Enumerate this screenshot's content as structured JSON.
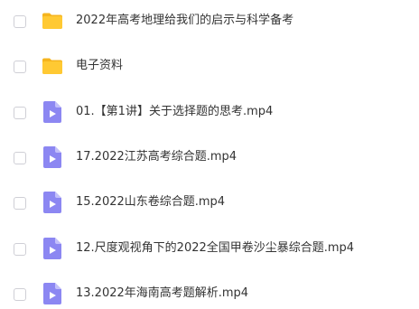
{
  "files": [
    {
      "name": "2022年高考地理给我们的启示与科学备考",
      "type": "folder",
      "icon": "folder-icon"
    },
    {
      "name": "电子资料",
      "type": "folder",
      "icon": "folder-icon"
    },
    {
      "name": "01.【第1讲】关于选择题的思考.mp4",
      "type": "video",
      "icon": "video-file-icon"
    },
    {
      "name": "17.2022江苏高考综合题.mp4",
      "type": "video",
      "icon": "video-file-icon"
    },
    {
      "name": "15.2022山东卷综合题.mp4",
      "type": "video",
      "icon": "video-file-icon"
    },
    {
      "name": "12.尺度观视角下的2022全国甲卷沙尘暴综合题.mp4",
      "type": "video",
      "icon": "video-file-icon"
    },
    {
      "name": "13.2022年海南高考题解析.mp4",
      "type": "video",
      "icon": "video-file-icon"
    }
  ],
  "colors": {
    "folder": "#FFC933",
    "folder_tab": "#F5B41E",
    "video": "#8C87F2",
    "video_fold": "#C3C0FA",
    "text": "#333333",
    "checkbox_border": "#CFCFD6"
  }
}
